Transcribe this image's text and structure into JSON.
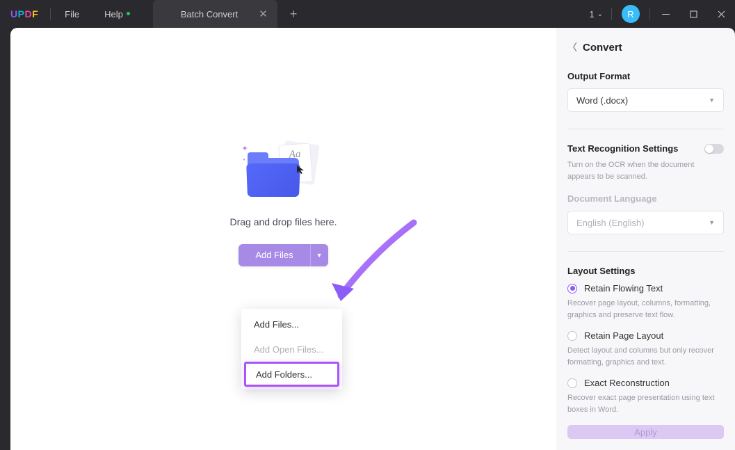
{
  "titlebar": {
    "logo": {
      "u": "U",
      "p": "P",
      "d": "D",
      "f": "F"
    },
    "file": "File",
    "help": "Help",
    "tab_title": "Batch Convert",
    "page_num": "1",
    "avatar": "R"
  },
  "main": {
    "dropzone_text": "Drag and drop files here.",
    "add_files_label": "Add Files",
    "doc_glyph": "Aa",
    "dropdown": {
      "add_files": "Add Files...",
      "add_open_files": "Add Open Files...",
      "add_folders": "Add Folders..."
    }
  },
  "side": {
    "title": "Convert",
    "output_format_label": "Output Format",
    "output_format_value": "Word (.docx)",
    "text_recog_label": "Text Recognition Settings",
    "text_recog_hint": "Turn on the OCR when the document appears to be scanned.",
    "doc_lang_label": "Document Language",
    "doc_lang_value": "English (English)",
    "layout_label": "Layout Settings",
    "radios": {
      "flowing_label": "Retain Flowing Text",
      "flowing_desc": "Recover page layout, columns, formatting, graphics and preserve text flow.",
      "page_label": "Retain Page Layout",
      "page_desc": "Detect layout and columns but only recover formatting, graphics and text.",
      "exact_label": "Exact Reconstruction",
      "exact_desc": "Recover exact page presentation using text boxes in Word."
    },
    "apply": "Apply"
  }
}
